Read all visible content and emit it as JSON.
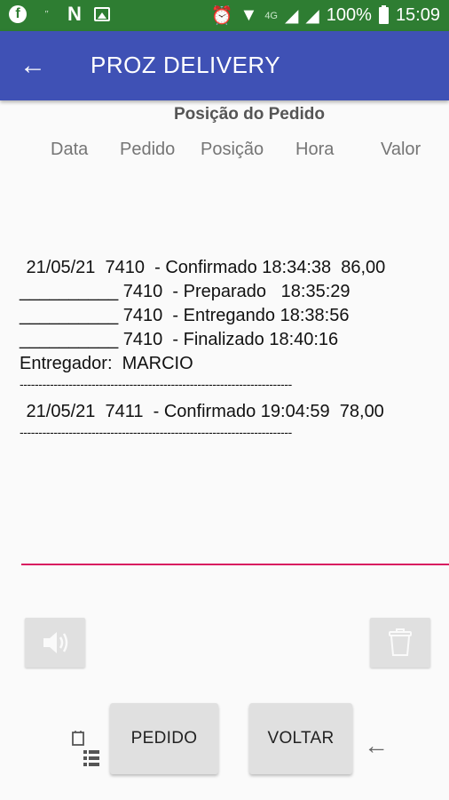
{
  "status_bar": {
    "left_icons": [
      "facebook-icon",
      "app-badge-icon",
      "netflix-icon",
      "image-icon"
    ],
    "network_label": "4G",
    "battery": "100%",
    "time": "15:09"
  },
  "app_bar": {
    "title": "PROZ DELIVERY"
  },
  "section_title": "Posição do Pedido",
  "columns": [
    "Data",
    "Pedido",
    "Posição",
    "Hora",
    "Valor"
  ],
  "log_lines": [
    " 21/05/21  7410  - Confirmado 18:34:38  86,00",
    "__________ 7410  - Preparado   18:35:29",
    "__________ 7410  - Entregando 18:38:56",
    "__________ 7410  - Finalizado 18:40:16",
    "Entregador:  MARCIO",
    "------------------------------------------------------------------------",
    " 21/05/21  7411  - Confirmado 19:04:59  78,00",
    "------------------------------------------------------------------------"
  ],
  "buttons": {
    "pedido": "PEDIDO",
    "voltar": "VOLTAR"
  },
  "colors": {
    "status_bar": "#2e7d32",
    "app_bar": "#3f51b5",
    "accent_underline": "#d81b60"
  }
}
